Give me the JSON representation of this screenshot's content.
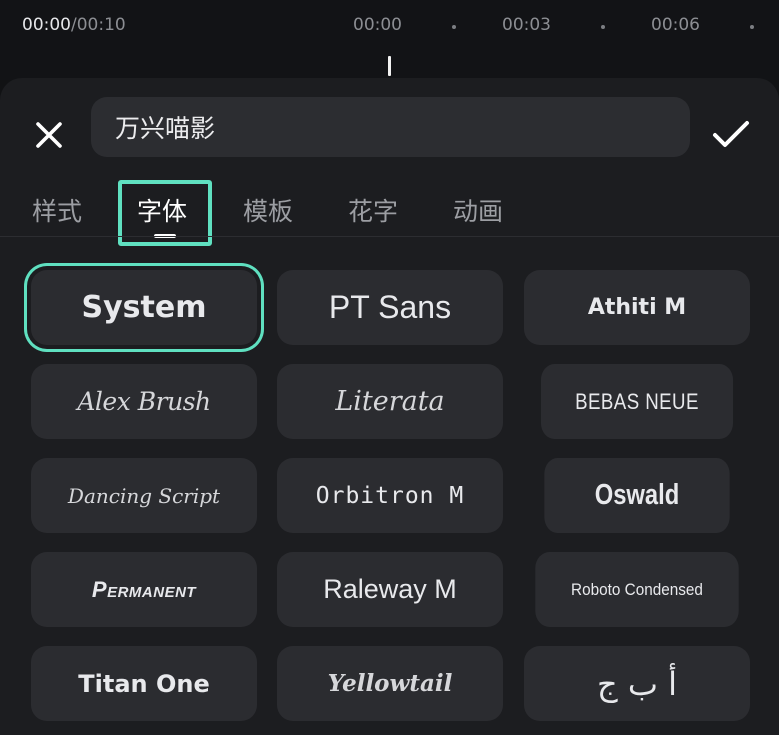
{
  "timeline": {
    "current": "00:00",
    "separator": "/",
    "total": "00:10",
    "ruler": [
      "00:00",
      "00:03",
      "00:06"
    ]
  },
  "editor": {
    "text_value": "万兴喵影",
    "close_icon": "close-icon",
    "confirm_icon": "checkmark-icon"
  },
  "tabs": [
    {
      "label": "样式"
    },
    {
      "label": "字体"
    },
    {
      "label": "模板"
    },
    {
      "label": "花字"
    },
    {
      "label": "动画"
    }
  ],
  "active_tab": "字体",
  "fonts": [
    {
      "label": "System"
    },
    {
      "label": "PT Sans"
    },
    {
      "label": "Athiti M"
    },
    {
      "label": "Alex Brush"
    },
    {
      "label": "Literata"
    },
    {
      "label": "BEBAS NEUE"
    },
    {
      "label": "Dancing Script"
    },
    {
      "label": "Orbitron M"
    },
    {
      "label": "Oswald"
    },
    {
      "label": "Permanent"
    },
    {
      "label": "Raleway M"
    },
    {
      "label": "Roboto Condensed"
    },
    {
      "label": "Titan One"
    },
    {
      "label": "Yellowtail"
    },
    {
      "label": "أ ب ج"
    }
  ],
  "selected_font": "System",
  "colors": {
    "accent": "#5fe0c0",
    "panel": "#1c1d20",
    "card": "#2b2c30",
    "input": "#2c2d31"
  }
}
